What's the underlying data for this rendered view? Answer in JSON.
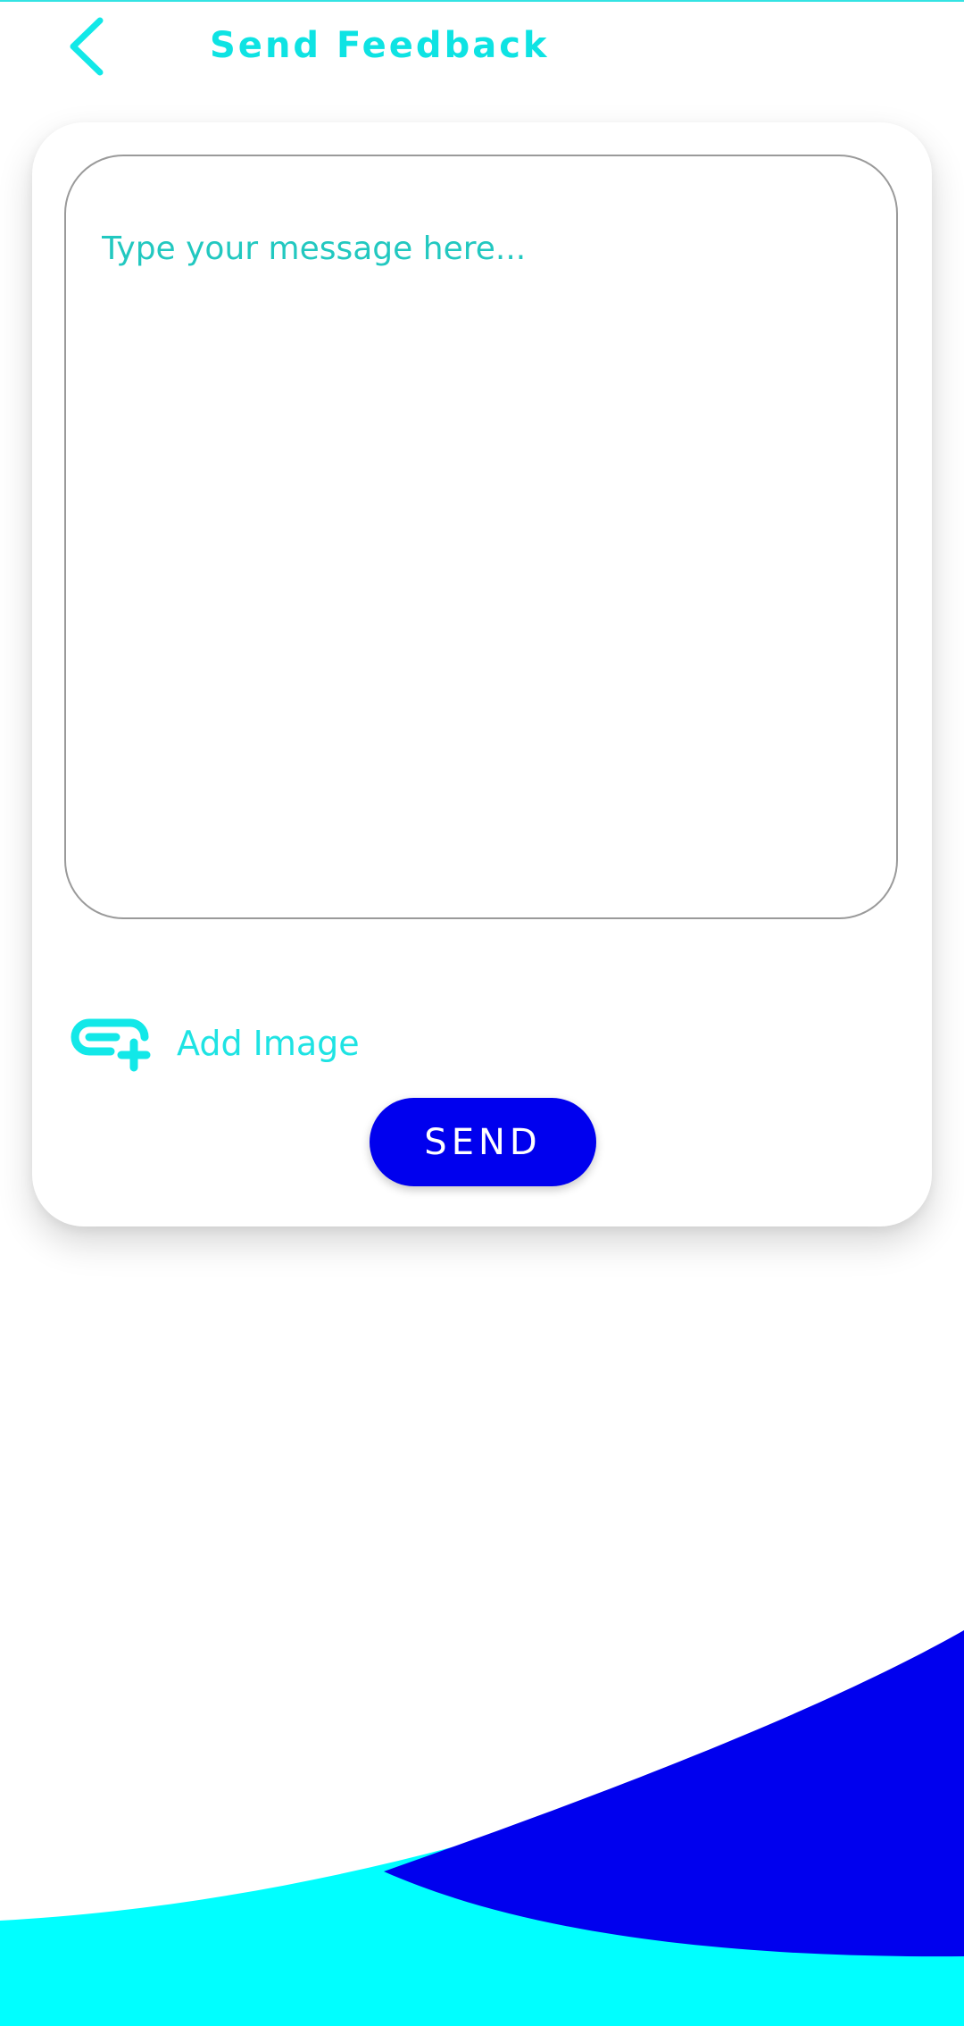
{
  "header": {
    "title": "Send Feedback",
    "back_icon": "chevron-left-icon"
  },
  "form": {
    "message_placeholder": "Type your message here...",
    "message_value": "",
    "add_image_label": "Add Image",
    "add_image_icon": "attach-add-icon",
    "send_label": "SEND"
  },
  "colors": {
    "accent_cyan": "#00FFFF",
    "accent_blue": "#0000EE",
    "placeholder_teal": "#22C8C0",
    "background": "#FFFFFF"
  }
}
